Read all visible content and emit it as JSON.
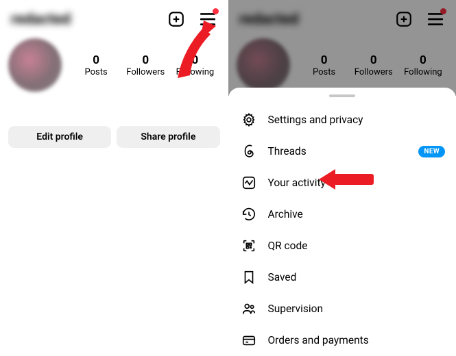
{
  "left": {
    "username": "redacted",
    "stats": [
      {
        "count": "0",
        "label": "Posts"
      },
      {
        "count": "0",
        "label": "Followers"
      },
      {
        "count": "0",
        "label": "Following"
      }
    ],
    "buttons": {
      "edit": "Edit profile",
      "share": "Share profile"
    }
  },
  "right": {
    "username": "redacted",
    "stats": [
      {
        "count": "0",
        "label": "Posts"
      },
      {
        "count": "0",
        "label": "Followers"
      },
      {
        "count": "0",
        "label": "Following"
      }
    ],
    "badge_new": "NEW",
    "menu": [
      {
        "icon": "settings",
        "label": "Settings and privacy"
      },
      {
        "icon": "threads",
        "label": "Threads"
      },
      {
        "icon": "activity",
        "label": "Your activity"
      },
      {
        "icon": "archive",
        "label": "Archive"
      },
      {
        "icon": "qr",
        "label": "QR code"
      },
      {
        "icon": "saved",
        "label": "Saved"
      },
      {
        "icon": "supervision",
        "label": "Supervision"
      },
      {
        "icon": "orders",
        "label": "Orders and payments"
      }
    ]
  }
}
